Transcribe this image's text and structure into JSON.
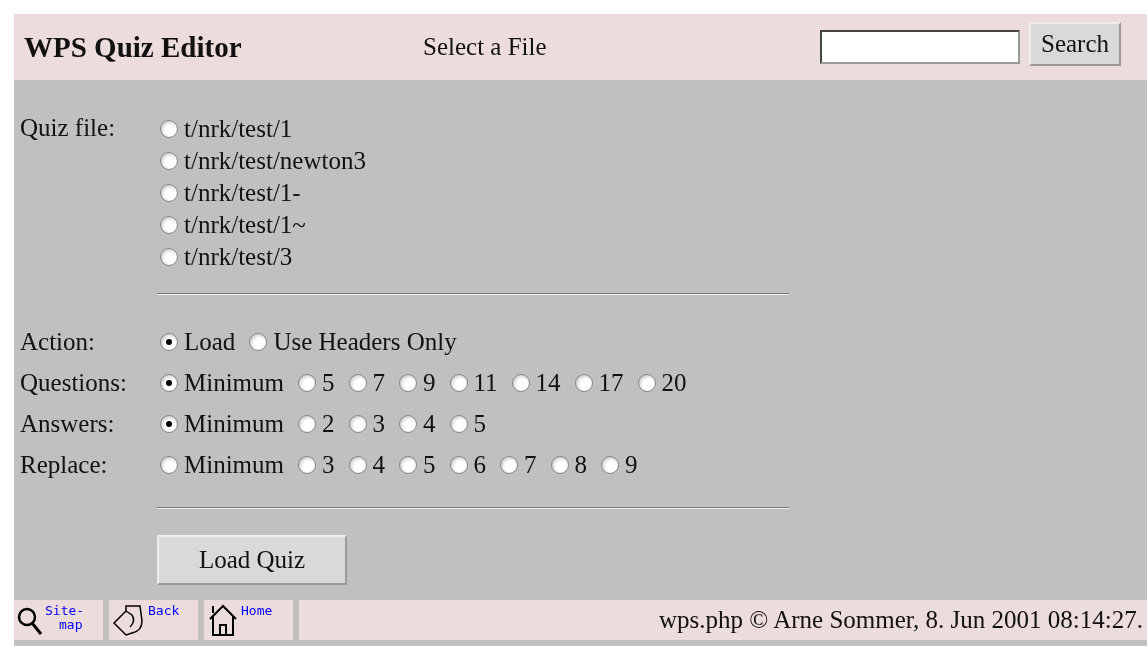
{
  "header": {
    "title": "WPS Quiz Editor",
    "subtitle": "Select a File",
    "search": {
      "button": "Search"
    }
  },
  "quiz_file": {
    "label": "Quiz file:",
    "options": [
      {
        "label": "t/nrk/test/1",
        "selected": false
      },
      {
        "label": "t/nrk/test/newton3",
        "selected": false
      },
      {
        "label": "t/nrk/test/1-",
        "selected": false
      },
      {
        "label": "t/nrk/test/1~",
        "selected": false
      },
      {
        "label": "t/nrk/test/3",
        "selected": false
      }
    ]
  },
  "settings": [
    {
      "label": "Action:",
      "options": [
        {
          "label": "Load",
          "selected": true
        },
        {
          "label": "Use Headers Only",
          "selected": false
        }
      ]
    },
    {
      "label": "Questions:",
      "options": [
        {
          "label": "Minimum",
          "selected": true
        },
        {
          "label": "5",
          "selected": false
        },
        {
          "label": "7",
          "selected": false
        },
        {
          "label": "9",
          "selected": false
        },
        {
          "label": "11",
          "selected": false
        },
        {
          "label": "14",
          "selected": false
        },
        {
          "label": "17",
          "selected": false
        },
        {
          "label": "20",
          "selected": false
        }
      ]
    },
    {
      "label": "Answers:",
      "options": [
        {
          "label": "Minimum",
          "selected": true
        },
        {
          "label": "2",
          "selected": false
        },
        {
          "label": "3",
          "selected": false
        },
        {
          "label": "4",
          "selected": false
        },
        {
          "label": "5",
          "selected": false
        }
      ]
    },
    {
      "label": "Replace:",
      "options": [
        {
          "label": "Minimum",
          "selected": false
        },
        {
          "label": "3",
          "selected": false
        },
        {
          "label": "4",
          "selected": false
        },
        {
          "label": "5",
          "selected": false
        },
        {
          "label": "6",
          "selected": false
        },
        {
          "label": "7",
          "selected": false
        },
        {
          "label": "8",
          "selected": false
        },
        {
          "label": "9",
          "selected": false
        }
      ]
    }
  ],
  "submit": "Load Quiz",
  "footer": {
    "links": [
      {
        "kind": "sitemap",
        "lines": [
          "Site-",
          "map"
        ]
      },
      {
        "kind": "back",
        "lines": [
          "Back"
        ]
      },
      {
        "kind": "home",
        "lines": [
          "Home"
        ]
      }
    ],
    "credit": "wps.php © Arne Sommer, 8. Jun 2001 08:14:27."
  }
}
